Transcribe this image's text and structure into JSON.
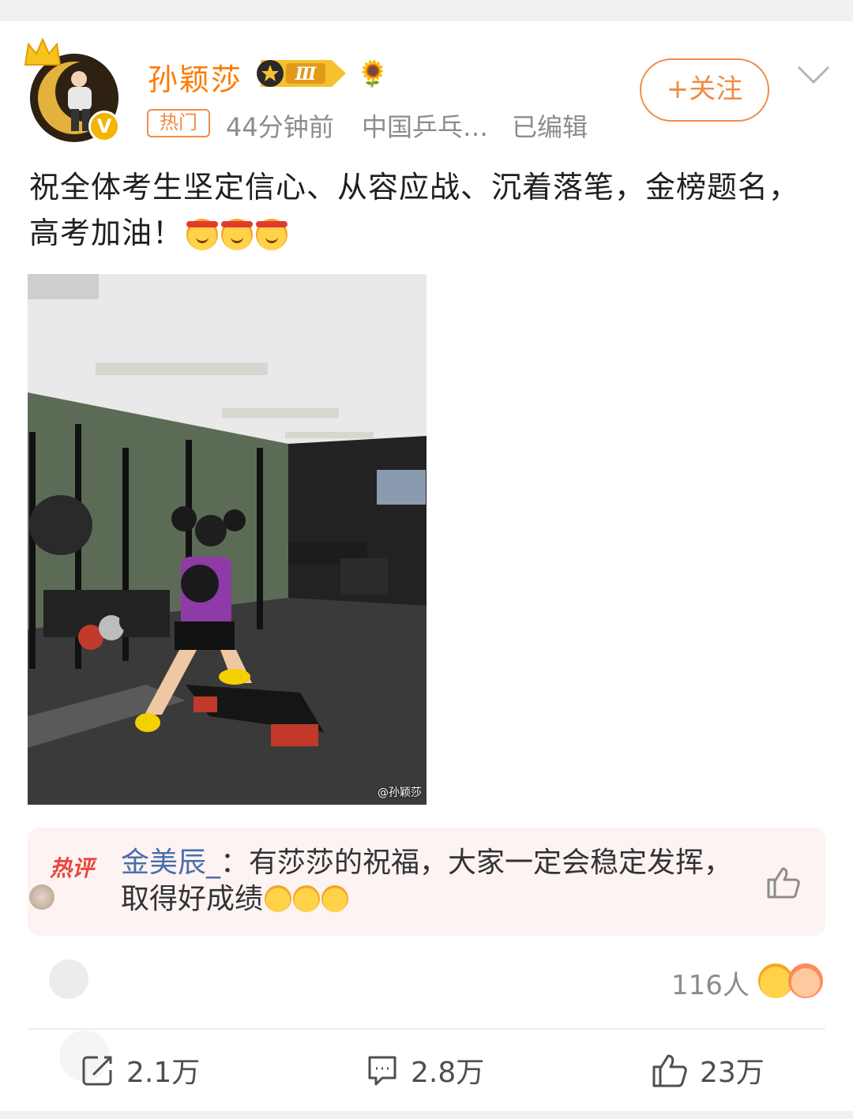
{
  "post": {
    "author": {
      "name": "孙颖莎",
      "level_badge": "Ⅲ",
      "verified_badge": "V"
    },
    "tag": "热门",
    "time": "44分钟前",
    "source": "中国乒乓…",
    "edited": "已编辑",
    "follow_label": "+关注",
    "text": "祝全体考生坚定信心、从容应战、沉着落笔，金榜题名，高考加油！",
    "photo_watermark": "@孙颖莎"
  },
  "hot_comment": {
    "label": "热评",
    "user": "金美辰_",
    "separator": "：",
    "text": "有莎莎的祝福，大家一定会稳定发挥，取得好成绩"
  },
  "likes_row": {
    "count": "116人"
  },
  "actions": {
    "repost": "2.1万",
    "comment": "2.8万",
    "like": "23万"
  }
}
